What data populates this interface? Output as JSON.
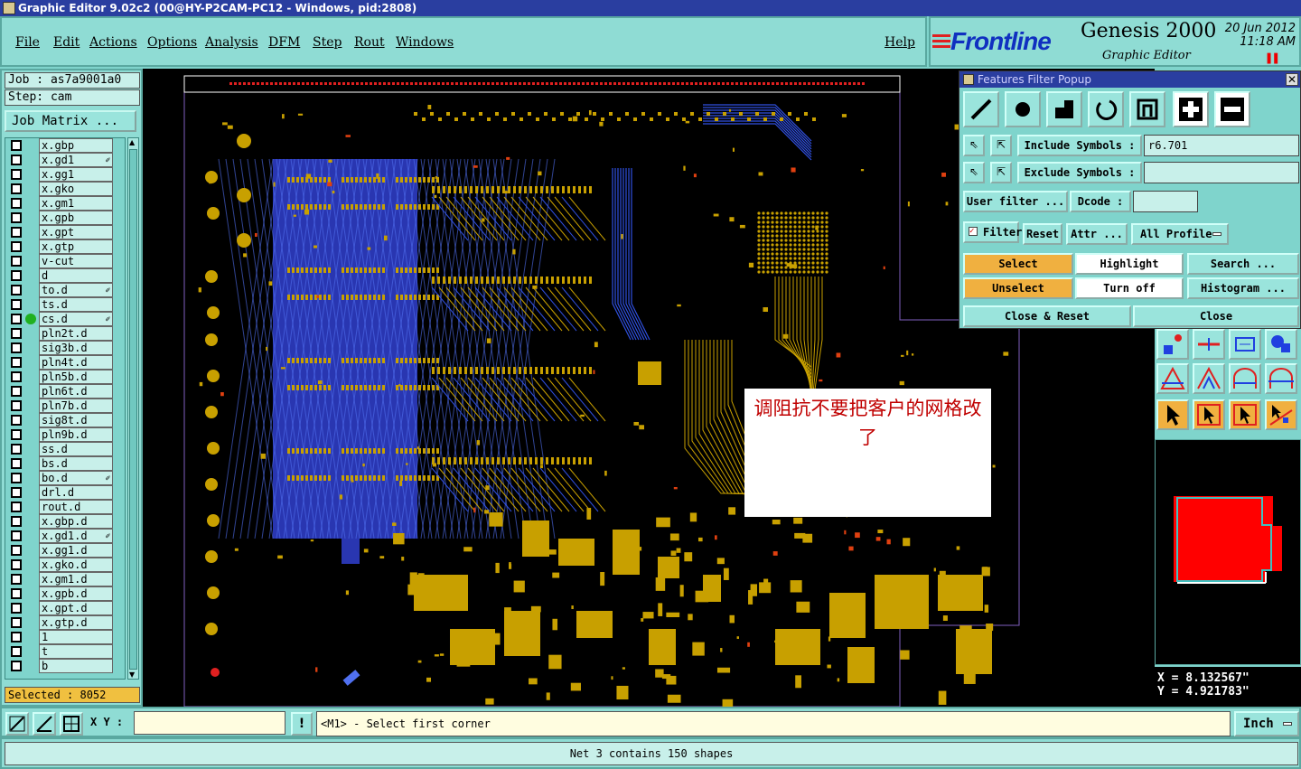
{
  "window": {
    "title": "Graphic Editor 9.02c2 (00@HY-P2CAM-PC12 - Windows, pid:2808)"
  },
  "menu": {
    "items": [
      "File",
      "Edit",
      "Actions",
      "Options",
      "Analysis",
      "DFM",
      "Step",
      "Rout",
      "Windows"
    ],
    "help": "Help"
  },
  "brand": {
    "logo": "Frontline",
    "product": "Genesis 2000",
    "module": "Graphic Editor",
    "date": "20 Jun 2012",
    "time": "11:18 AM"
  },
  "left": {
    "job": "Job : as7a9001a0",
    "step": "Step: cam",
    "job_matrix": "Job Matrix ...",
    "selected": "Selected : 8052",
    "layers": [
      {
        "name": "x.gbp",
        "mark": ""
      },
      {
        "name": "x.gd1",
        "mark": "✐"
      },
      {
        "name": "x.gg1",
        "mark": ""
      },
      {
        "name": "x.gko",
        "mark": ""
      },
      {
        "name": "x.gm1",
        "mark": ""
      },
      {
        "name": "x.gpb",
        "mark": ""
      },
      {
        "name": "x.gpt",
        "mark": ""
      },
      {
        "name": "x.gtp",
        "mark": ""
      },
      {
        "name": "v-cut",
        "mark": ""
      },
      {
        "name": "d",
        "mark": ""
      },
      {
        "name": "to.d",
        "mark": "✐"
      },
      {
        "name": "ts.d",
        "mark": ""
      },
      {
        "name": "cs.d",
        "mark": "✐",
        "active": true
      },
      {
        "name": "pln2t.d",
        "mark": ""
      },
      {
        "name": "sig3b.d",
        "mark": ""
      },
      {
        "name": "pln4t.d",
        "mark": ""
      },
      {
        "name": "pln5b.d",
        "mark": ""
      },
      {
        "name": "pln6t.d",
        "mark": ""
      },
      {
        "name": "pln7b.d",
        "mark": ""
      },
      {
        "name": "sig8t.d",
        "mark": ""
      },
      {
        "name": "pln9b.d",
        "mark": ""
      },
      {
        "name": "ss.d",
        "mark": ""
      },
      {
        "name": "bs.d",
        "mark": ""
      },
      {
        "name": "bo.d",
        "mark": "✐"
      },
      {
        "name": "drl.d",
        "mark": ""
      },
      {
        "name": "rout.d",
        "mark": ""
      },
      {
        "name": "x.gbp.d",
        "mark": ""
      },
      {
        "name": "x.gd1.d",
        "mark": "✐"
      },
      {
        "name": "x.gg1.d",
        "mark": ""
      },
      {
        "name": "x.gko.d",
        "mark": ""
      },
      {
        "name": "x.gm1.d",
        "mark": ""
      },
      {
        "name": "x.gpb.d",
        "mark": ""
      },
      {
        "name": "x.gpt.d",
        "mark": ""
      },
      {
        "name": "x.gtp.d",
        "mark": ""
      },
      {
        "name": "1",
        "mark": ""
      },
      {
        "name": "t",
        "mark": ""
      },
      {
        "name": "b",
        "mark": ""
      }
    ]
  },
  "filter": {
    "title": "Features Filter Popup",
    "include_label": "Include Symbols :",
    "include_value": "r6.701",
    "exclude_label": "Exclude Symbols :",
    "exclude_value": "",
    "user_filter": "User filter ...",
    "dcode_label": "Dcode :",
    "dcode_value": "",
    "filter_label": "Filter",
    "reset": "Reset",
    "attr": "Attr ...",
    "profile": "All Profile",
    "select": "Select",
    "highlight": "Highlight",
    "search": "Search ...",
    "unselect": "Unselect",
    "turn_off": "Turn off",
    "histogram": "Histogram ...",
    "close_reset": "Close & Reset",
    "close": "Close"
  },
  "note": {
    "text": "调阻抗不要把客户的网格改了"
  },
  "coords": {
    "x": "X = 8.132567\"",
    "y": "Y = 4.921783\""
  },
  "bottom": {
    "xy_label": "X Y :",
    "excl": "!",
    "prompt": "<M1> - Select first corner",
    "unit": "Inch"
  },
  "status": {
    "text": "Net 3 contains 150 shapes"
  },
  "colors": {
    "panel": "#8fdcd4",
    "title": "#2a3ea0",
    "copper": "#c8a000",
    "trace_blue": "#3050e0",
    "selected": "#f0c040"
  }
}
